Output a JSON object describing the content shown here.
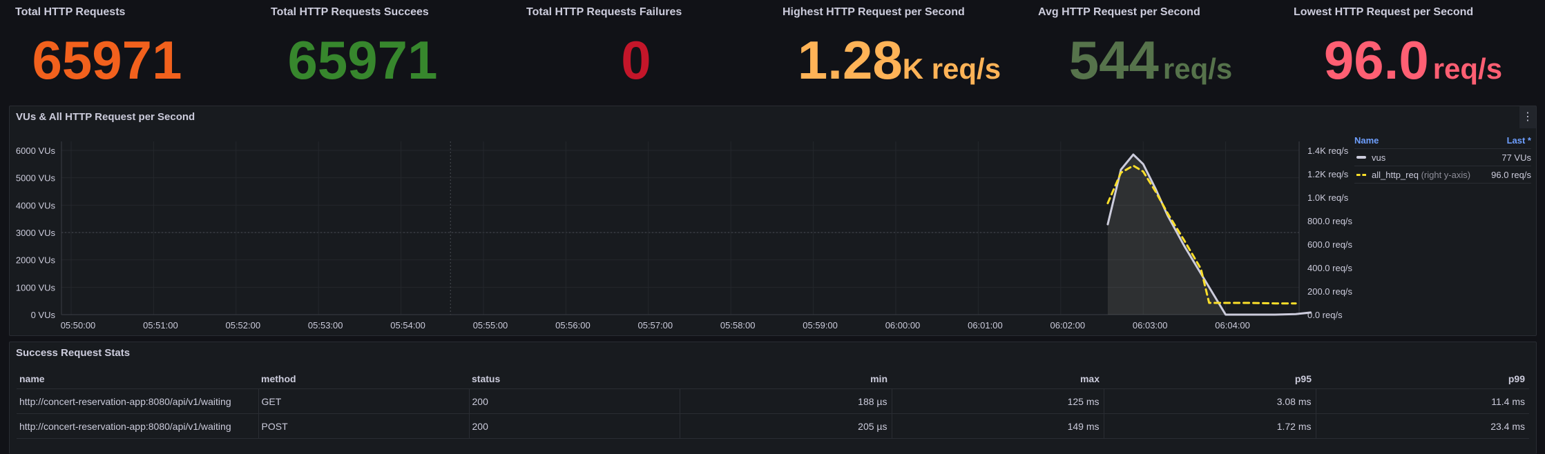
{
  "stats": [
    {
      "title": "Total HTTP Requests",
      "value": "65971",
      "unit": "",
      "color": "#f2611d"
    },
    {
      "title": "Total HTTP Requests Succees",
      "value": "65971",
      "unit": "",
      "color": "#37872d"
    },
    {
      "title": "Total HTTP Requests Failures",
      "value": "0",
      "unit": "",
      "color": "#c4162a"
    },
    {
      "title": "Highest HTTP Request per Second",
      "value": "1.28",
      "unit": "K req/s",
      "color": "#ffb357"
    },
    {
      "title": "Avg HTTP Request per Second",
      "value": "544",
      "unit": "req/s",
      "color": "#56734b"
    },
    {
      "title": "Lowest HTTP Request per Second",
      "value": "96.0",
      "unit": "req/s",
      "color": "#ff5f73"
    }
  ],
  "chart_panel": {
    "title": "VUs & All HTTP Request per Second",
    "menu_icon": "vertical-ellipsis-icon"
  },
  "chart_data": {
    "type": "line",
    "x_ticks": [
      "05:50:00",
      "05:51:00",
      "05:52:00",
      "05:53:00",
      "05:54:00",
      "05:55:00",
      "05:56:00",
      "05:57:00",
      "05:58:00",
      "05:59:00",
      "06:00:00",
      "06:01:00",
      "06:02:00",
      "06:03:00",
      "06:04:00"
    ],
    "left_ticks": [
      "0 VUs",
      "1000 VUs",
      "2000 VUs",
      "3000 VUs",
      "4000 VUs",
      "5000 VUs",
      "6000 VUs"
    ],
    "right_ticks": [
      "0.0 req/s",
      "200.0 req/s",
      "400.0 req/s",
      "600.0 req/s",
      "800.0 req/s",
      "1.0K req/s",
      "1.2K req/s",
      "1.4K req/s"
    ],
    "ylim_left": [
      0,
      6000
    ],
    "ylim_right": [
      0,
      1400
    ],
    "x_range_min": [
      0,
      15.1
    ],
    "series": [
      {
        "name": "vus",
        "axis": "left",
        "color": "#ccccdc",
        "style": "solid",
        "fill": "rgba(204,204,188,0.12)",
        "x": [
          12.57,
          12.73,
          12.88,
          13.0,
          13.15,
          13.3,
          13.5,
          13.7,
          14.0,
          14.3,
          14.6,
          14.85,
          15.03
        ],
        "y": [
          3300,
          5300,
          5850,
          5500,
          4600,
          3600,
          2500,
          1500,
          0,
          0,
          0,
          20,
          77
        ]
      },
      {
        "name": "all_http_req",
        "axis": "right",
        "color": "#fade2a",
        "style": "dashed",
        "x": [
          12.57,
          12.73,
          12.88,
          13.0,
          13.15,
          13.3,
          13.5,
          13.7,
          13.8,
          14.0,
          14.3,
          14.6,
          14.85
        ],
        "y": [
          950,
          1210,
          1270,
          1220,
          1050,
          860,
          630,
          390,
          100,
          100,
          100,
          96,
          96
        ]
      }
    ]
  },
  "legend": {
    "name_header": "Name",
    "last_header": "Last *",
    "rows": [
      {
        "name": "vus",
        "sub": "",
        "last": "77 VUs"
      },
      {
        "name": "all_http_req",
        "sub": "(right y-axis)",
        "last": "96.0 req/s"
      }
    ]
  },
  "table_panel": {
    "title": "Success Request Stats",
    "headers": [
      "name",
      "method",
      "status",
      "min",
      "max",
      "p95",
      "p99"
    ],
    "rows": [
      [
        "http://concert-reservation-app:8080/api/v1/waiting",
        "GET",
        "200",
        "188 µs",
        "125 ms",
        "3.08 ms",
        "11.4 ms"
      ],
      [
        "http://concert-reservation-app:8080/api/v1/waiting",
        "POST",
        "200",
        "205 µs",
        "149 ms",
        "1.72 ms",
        "23.4 ms"
      ]
    ]
  }
}
